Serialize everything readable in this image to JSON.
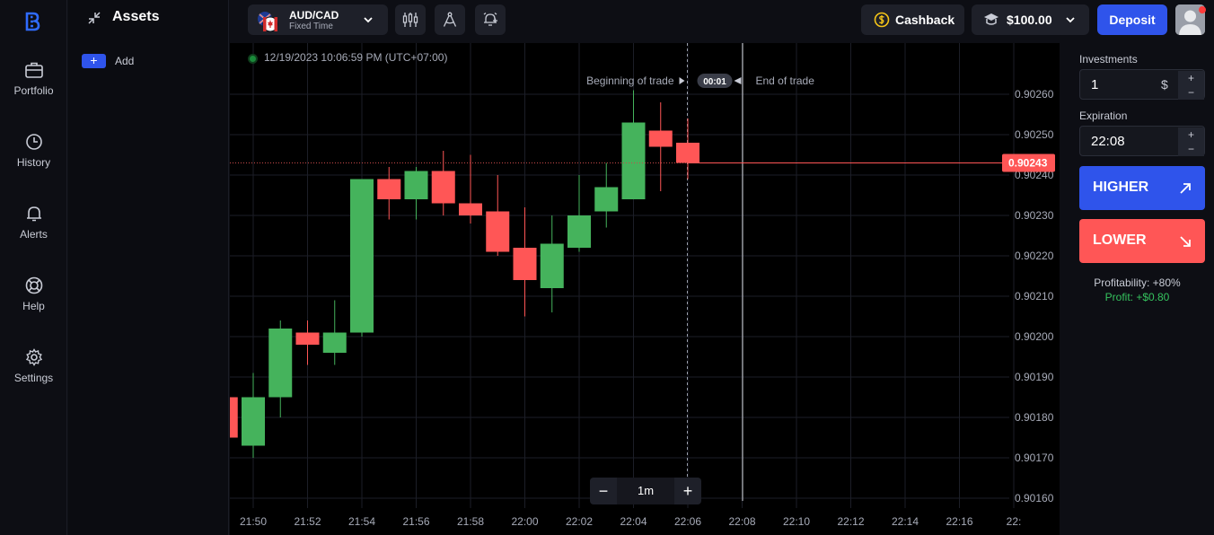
{
  "nav": {
    "logo_icon": "b-logo-icon",
    "items": [
      {
        "label": "Portfolio",
        "icon": "briefcase-icon"
      },
      {
        "label": "History",
        "icon": "clock-icon"
      },
      {
        "label": "Alerts",
        "icon": "bell-icon"
      },
      {
        "label": "Help",
        "icon": "lifebuoy-icon"
      },
      {
        "label": "Settings",
        "icon": "gear-icon"
      }
    ]
  },
  "assets": {
    "title": "Assets",
    "add_label": "Add",
    "add_symbol": "+"
  },
  "topbar": {
    "pair_name": "AUD/CAD",
    "pair_type": "Fixed Time",
    "cashback_label": "Cashback",
    "balance": "$100.00",
    "deposit_label": "Deposit"
  },
  "chart_data": {
    "type": "candlestick",
    "timestamp": "12/19/2023 10:06:59 PM (UTC+07:00)",
    "current_price_label": "0.90243",
    "current_price": 0.90243,
    "y_ticks": [
      "0.90260",
      "0.90250",
      "0.90240",
      "0.90230",
      "0.90220",
      "0.90210",
      "0.90200",
      "0.90190",
      "0.90180",
      "0.90170",
      "0.90160"
    ],
    "x_ticks": [
      "21:50",
      "21:52",
      "21:54",
      "21:56",
      "21:58",
      "22:00",
      "22:02",
      "22:04",
      "22:06",
      "22:08",
      "22:10",
      "22:12",
      "22:14",
      "22:16",
      "22:"
    ],
    "ylim": [
      0.90157,
      0.90276
    ],
    "trade": {
      "begin_label": "Beginning of trade",
      "countdown": "00:01",
      "end_label": "End of trade",
      "begin_time": "22:06",
      "end_time": "22:08"
    },
    "candles": [
      {
        "t": "21:49",
        "o": 0.90185,
        "h": 0.90185,
        "l": 0.90175,
        "c": 0.90175
      },
      {
        "t": "21:50",
        "o": 0.90173,
        "h": 0.90191,
        "l": 0.9017,
        "c": 0.90185
      },
      {
        "t": "21:51",
        "o": 0.90185,
        "h": 0.90204,
        "l": 0.9018,
        "c": 0.90202
      },
      {
        "t": "21:52",
        "o": 0.90201,
        "h": 0.90204,
        "l": 0.90193,
        "c": 0.90198
      },
      {
        "t": "21:53",
        "o": 0.90196,
        "h": 0.90209,
        "l": 0.90193,
        "c": 0.90201
      },
      {
        "t": "21:54",
        "o": 0.90201,
        "h": 0.90239,
        "l": 0.902,
        "c": 0.90239
      },
      {
        "t": "21:55",
        "o": 0.90239,
        "h": 0.90242,
        "l": 0.90229,
        "c": 0.90234
      },
      {
        "t": "21:56",
        "o": 0.90234,
        "h": 0.90242,
        "l": 0.90229,
        "c": 0.90241
      },
      {
        "t": "21:57",
        "o": 0.90241,
        "h": 0.90246,
        "l": 0.9023,
        "c": 0.90233
      },
      {
        "t": "21:58",
        "o": 0.90233,
        "h": 0.90245,
        "l": 0.90228,
        "c": 0.9023
      },
      {
        "t": "21:59",
        "o": 0.90231,
        "h": 0.9024,
        "l": 0.9022,
        "c": 0.90221
      },
      {
        "t": "22:00",
        "o": 0.90222,
        "h": 0.90232,
        "l": 0.90205,
        "c": 0.90214
      },
      {
        "t": "22:01",
        "o": 0.90212,
        "h": 0.9023,
        "l": 0.90206,
        "c": 0.90223
      },
      {
        "t": "22:02",
        "o": 0.90222,
        "h": 0.9024,
        "l": 0.90221,
        "c": 0.9023
      },
      {
        "t": "22:03",
        "o": 0.90231,
        "h": 0.90243,
        "l": 0.90227,
        "c": 0.90237
      },
      {
        "t": "22:04",
        "o": 0.90234,
        "h": 0.90261,
        "l": 0.90234,
        "c": 0.90253
      },
      {
        "t": "22:05",
        "o": 0.90251,
        "h": 0.90258,
        "l": 0.90236,
        "c": 0.90247
      },
      {
        "t": "22:06",
        "o": 0.90248,
        "h": 0.90254,
        "l": 0.90239,
        "c": 0.90243
      }
    ]
  },
  "zoom": {
    "minus": "−",
    "level": "1m",
    "plus": "+"
  },
  "panel": {
    "investments_label": "Investments",
    "investment_value": "1",
    "currency": "$",
    "expiration_label": "Expiration",
    "expiration_value": "22:08",
    "plus": "+",
    "minus": "−",
    "higher_label": "HIGHER",
    "lower_label": "LOWER",
    "profitability": "Profitability: +80%",
    "profit": "Profit: +$0.80"
  },
  "colors": {
    "up": "#45b35c",
    "down": "#ff5656",
    "accent": "#2f54eb",
    "profit": "#35c35e"
  }
}
